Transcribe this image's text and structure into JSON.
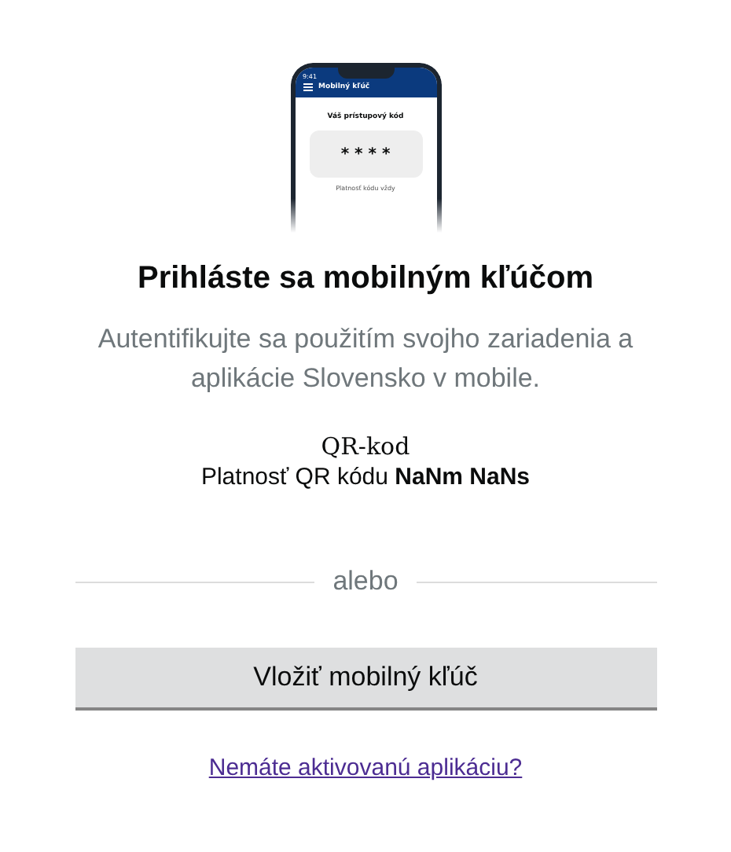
{
  "phone": {
    "time": "9:41",
    "app_title": "Mobilný kľúč",
    "code_label": "Váš prístupový kód",
    "code": "* * * *",
    "validity": "Platnosť kódu vždy"
  },
  "title": "Prihláste sa mobilným kľúčom",
  "description": "Autentifikujte sa použitím svojho zariadenia a aplikácie Slovensko v mobile.",
  "qr_alt": "QR-kod",
  "qr_validity": "Platnosť QR kódu **NaNm NaNs**",
  "divider": "alebo",
  "button": "Vložiť mobilný kľúč",
  "link": "Nemáte aktivovanú aplikáciu?"
}
